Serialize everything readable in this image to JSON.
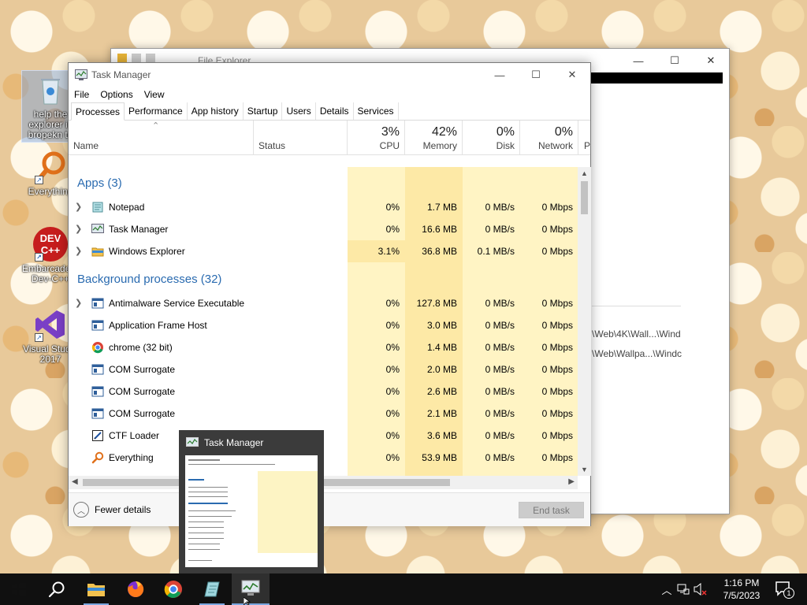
{
  "desktop": {
    "icons": [
      {
        "label": "help the explorer is bropekn to"
      },
      {
        "label": "Everything"
      },
      {
        "label": "Embarcadero Dev-C++"
      },
      {
        "label": "Visual Studio 2017"
      }
    ]
  },
  "file_explorer": {
    "title": "File Explorer",
    "paths": [
      "\\Web\\4K\\Wall...\\Wind",
      "\\Web\\Wallpa...\\Windc"
    ]
  },
  "task_manager": {
    "title": "Task Manager",
    "menu": [
      "File",
      "Options",
      "View"
    ],
    "tabs": [
      "Processes",
      "Performance",
      "App history",
      "Startup",
      "Users",
      "Details",
      "Services"
    ],
    "active_tab": "Processes",
    "columns": {
      "name": "Name",
      "status": "Status",
      "cpu": {
        "pct": "3%",
        "label": "CPU"
      },
      "memory": {
        "pct": "42%",
        "label": "Memory"
      },
      "disk": {
        "pct": "0%",
        "label": "Disk"
      },
      "network": {
        "pct": "0%",
        "label": "Network"
      },
      "next": "P"
    },
    "groups": {
      "apps": "Apps (3)",
      "background": "Background processes (32)"
    },
    "apps": [
      {
        "name": "Notepad",
        "cpu": "0%",
        "memory": "1.7 MB",
        "disk": "0 MB/s",
        "network": "0 Mbps"
      },
      {
        "name": "Task Manager",
        "cpu": "0%",
        "memory": "16.6 MB",
        "disk": "0 MB/s",
        "network": "0 Mbps"
      },
      {
        "name": "Windows Explorer",
        "cpu": "3.1%",
        "memory": "36.8 MB",
        "disk": "0.1 MB/s",
        "network": "0 Mbps"
      }
    ],
    "background": [
      {
        "name": "Antimalware Service Executable",
        "cpu": "0%",
        "memory": "127.8 MB",
        "disk": "0 MB/s",
        "network": "0 Mbps"
      },
      {
        "name": "Application Frame Host",
        "cpu": "0%",
        "memory": "3.0 MB",
        "disk": "0 MB/s",
        "network": "0 Mbps"
      },
      {
        "name": "chrome (32 bit)",
        "cpu": "0%",
        "memory": "1.4 MB",
        "disk": "0 MB/s",
        "network": "0 Mbps"
      },
      {
        "name": "COM Surrogate",
        "cpu": "0%",
        "memory": "2.0 MB",
        "disk": "0 MB/s",
        "network": "0 Mbps"
      },
      {
        "name": "COM Surrogate",
        "cpu": "0%",
        "memory": "2.6 MB",
        "disk": "0 MB/s",
        "network": "0 Mbps"
      },
      {
        "name": "COM Surrogate",
        "cpu": "0%",
        "memory": "2.1 MB",
        "disk": "0 MB/s",
        "network": "0 Mbps"
      },
      {
        "name": "CTF Loader",
        "cpu": "0%",
        "memory": "3.6 MB",
        "disk": "0 MB/s",
        "network": "0 Mbps"
      },
      {
        "name": "Everything",
        "cpu": "0%",
        "memory": "53.9 MB",
        "disk": "0 MB/s",
        "network": "0 Mbps"
      }
    ],
    "fewer_details": "Fewer details",
    "end_task": "End task"
  },
  "thumbnail": {
    "title": "Task Manager"
  },
  "taskbar": {
    "apps": [
      "search",
      "file-explorer",
      "firefox",
      "chrome",
      "notepad",
      "task-manager"
    ],
    "time": "1:16 PM",
    "date": "7/5/2023",
    "notification_count": "1"
  },
  "colors": {
    "group_header": "#2a6bb0",
    "heat_light": "#fff4c4",
    "heat_medium": "#fde9a6",
    "taskbar": "#101010"
  }
}
